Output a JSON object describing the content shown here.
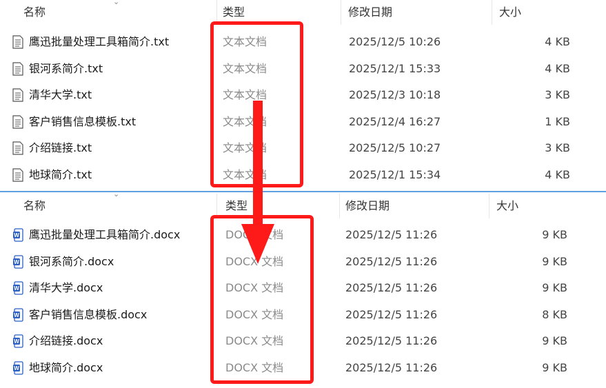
{
  "top_panel": {
    "columns": {
      "name": "名称",
      "type": "类型",
      "date": "修改日期",
      "size": "大小"
    },
    "files": [
      {
        "name": "鹰迅批量处理工具箱简介.txt",
        "type": "文本文档",
        "date": "2025/12/5 10:26",
        "size": "4 KB"
      },
      {
        "name": "银河系简介.txt",
        "type": "文本文档",
        "date": "2025/12/1 15:33",
        "size": "4 KB"
      },
      {
        "name": "清华大学.txt",
        "type": "文本文档",
        "date": "2025/12/3 10:18",
        "size": "3 KB"
      },
      {
        "name": "客户销售信息模板.txt",
        "type": "文本文档",
        "date": "2025/12/4 16:27",
        "size": "1 KB"
      },
      {
        "name": "介绍链接.txt",
        "type": "文本文档",
        "date": "2025/12/5 10:27",
        "size": "3 KB"
      },
      {
        "name": "地球简介.txt",
        "type": "文本文档",
        "date": "2025/12/1 15:34",
        "size": "4 KB"
      }
    ]
  },
  "bottom_panel": {
    "columns": {
      "name": "名称",
      "type": "类型",
      "date": "修改日期",
      "size": "大小"
    },
    "files": [
      {
        "name": "鹰迅批量处理工具箱简介.docx",
        "type": "DOCX 文档",
        "date": "2025/12/5 11:26",
        "size": "9 KB"
      },
      {
        "name": "银河系简介.docx",
        "type": "DOCX 文档",
        "date": "2025/12/5 11:26",
        "size": "9 KB"
      },
      {
        "name": "清华大学.docx",
        "type": "DOCX 文档",
        "date": "2025/12/5 11:26",
        "size": "9 KB"
      },
      {
        "name": "客户销售信息模板.docx",
        "type": "DOCX 文档",
        "date": "2025/12/5 11:26",
        "size": "8 KB"
      },
      {
        "name": "介绍链接.docx",
        "type": "DOCX 文档",
        "date": "2025/12/5 11:26",
        "size": "9 KB"
      },
      {
        "name": "地球简介.docx",
        "type": "DOCX 文档",
        "date": "2025/12/5 11:26",
        "size": "9 KB"
      }
    ]
  },
  "icons": {
    "txt": "text-file-icon",
    "docx": "word-docx-icon"
  },
  "colors": {
    "highlight": "#ff1a1a",
    "divider": "#5fa0e0",
    "word_blue": "#2b5fc5"
  }
}
